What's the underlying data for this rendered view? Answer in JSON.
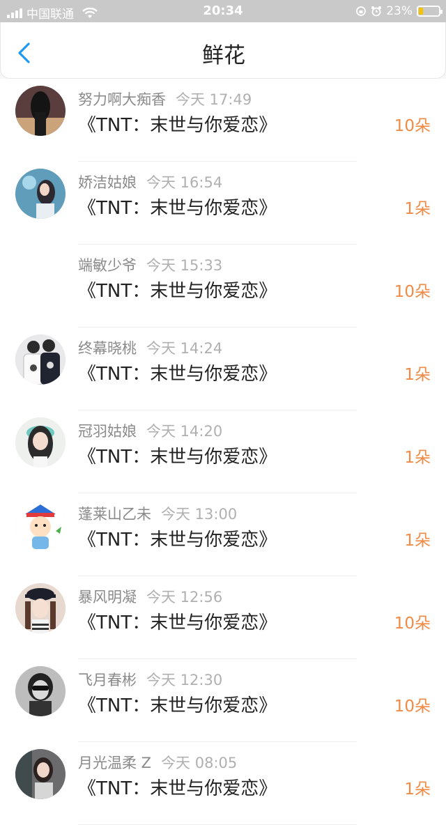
{
  "status_bar": {
    "carrier": "中国联通",
    "time": "20:34",
    "battery_percent": "23%",
    "battery_level": 0.23
  },
  "nav": {
    "title": "鲜花"
  },
  "items": [
    {
      "name": "努力啊大痴香",
      "time": "今天 17:49",
      "title": "《TNT：末世与你爱恋》",
      "count": "10朵",
      "avatar": "dark"
    },
    {
      "name": "娇洁姑娘",
      "time": "今天 16:54",
      "title": "《TNT：末世与你爱恋》",
      "count": "1朵",
      "avatar": "blue"
    },
    {
      "name": "端敏少爷",
      "time": "今天 15:33",
      "title": "《TNT：末世与你爱恋》",
      "count": "10朵",
      "avatar": "none"
    },
    {
      "name": "终幕晓桃",
      "time": "今天 14:24",
      "title": "《TNT：末世与你爱恋》",
      "count": "1朵",
      "avatar": "couple"
    },
    {
      "name": "冠羽姑娘",
      "time": "今天 14:20",
      "title": "《TNT：末世与你爱恋》",
      "count": "1朵",
      "avatar": "girl"
    },
    {
      "name": "蓬莱山乙未",
      "time": "今天 13:00",
      "title": "《TNT：末世与你爱恋》",
      "count": "1朵",
      "avatar": "cartoon"
    },
    {
      "name": "暴风明凝",
      "time": "今天 12:56",
      "title": "《TNT：末世与你爱恋》",
      "count": "10朵",
      "avatar": "cap"
    },
    {
      "name": "飞月春彬",
      "time": "今天 12:30",
      "title": "《TNT：末世与你爱恋》",
      "count": "10朵",
      "avatar": "bw"
    },
    {
      "name": "月光温柔 Z",
      "time": "今天 08:05",
      "title": "《TNT：末世与你爱恋》",
      "count": "1朵",
      "avatar": "photo"
    }
  ]
}
